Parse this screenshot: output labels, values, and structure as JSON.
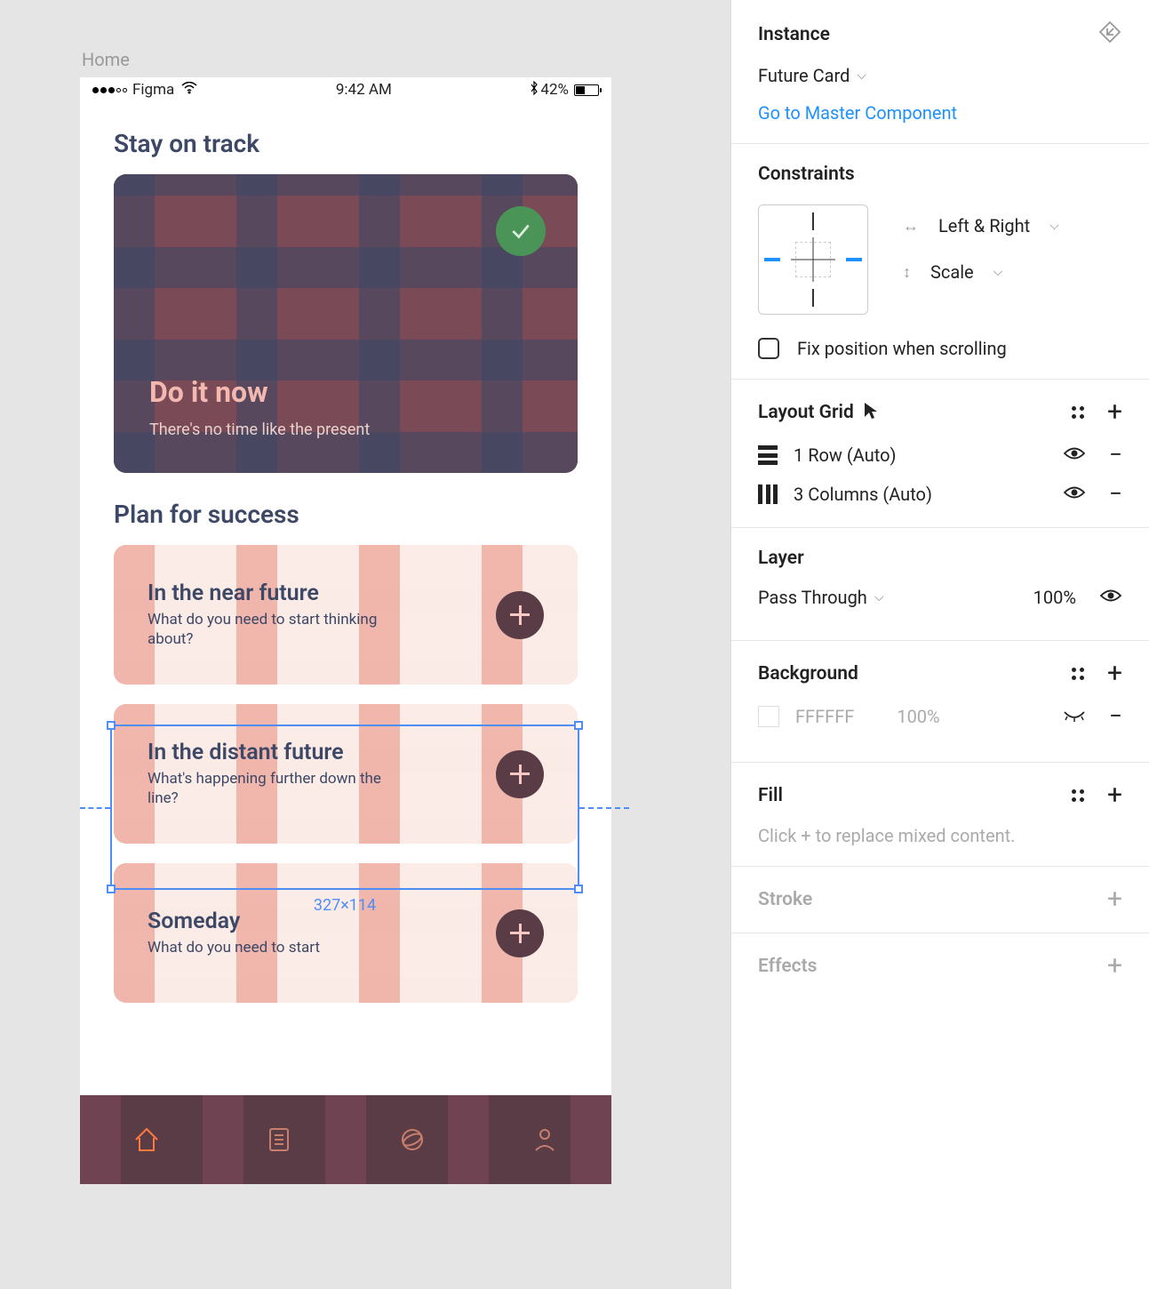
{
  "frame_label": "Home",
  "status_bar": {
    "carrier": "Figma",
    "time": "9:42 AM",
    "battery_pct": "42%"
  },
  "mock": {
    "section1_title": "Stay on track",
    "big_card": {
      "title": "Do it now",
      "subtitle": "There's no time like the present"
    },
    "section2_title": "Plan for success",
    "cards": [
      {
        "title": "In the near future",
        "subtitle": "What do you need to start thinking about?"
      },
      {
        "title": "In the distant future",
        "subtitle": "What's happening further down the line?"
      },
      {
        "title": "Someday",
        "subtitle": "What do you need to start"
      }
    ]
  },
  "selection_dims": "327×114",
  "inspector": {
    "instance_heading": "Instance",
    "instance_name": "Future Card",
    "go_master": "Go to Master Component",
    "constraints_heading": "Constraints",
    "constraint_h": "Left & Right",
    "constraint_v": "Scale",
    "fix_position_label": "Fix position when scrolling",
    "layout_grid_heading": "Layout Grid",
    "grid_rows": [
      {
        "label": "1 Row (Auto)"
      },
      {
        "label": "3 Columns (Auto)"
      }
    ],
    "layer_heading": "Layer",
    "layer_blend": "Pass Through",
    "layer_opacity": "100%",
    "background_heading": "Background",
    "bg_hex": "FFFFFF",
    "bg_opacity": "100%",
    "fill_heading": "Fill",
    "fill_hint": "Click + to replace mixed content.",
    "stroke_heading": "Stroke",
    "effects_heading": "Effects"
  }
}
